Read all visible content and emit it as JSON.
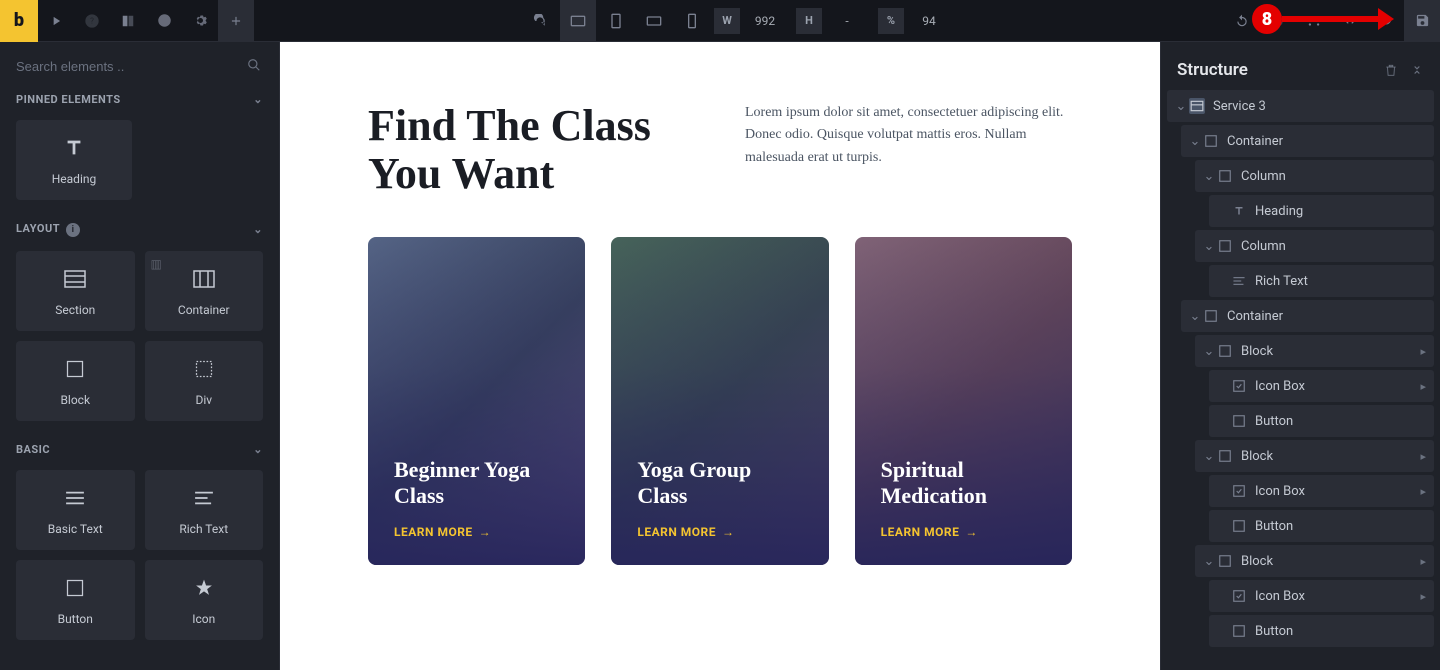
{
  "topbar": {
    "logo": "b",
    "dims": {
      "w_label": "W",
      "w_value": "992",
      "h_label": "H",
      "h_value": "-",
      "pct_label": "%",
      "pct_value": "94"
    }
  },
  "leftPanel": {
    "search_placeholder": "Search elements ..",
    "sections": {
      "pinned": "PINNED ELEMENTS",
      "layout": "LAYOUT",
      "basic": "BASIC"
    },
    "tiles": {
      "heading": "Heading",
      "section": "Section",
      "container": "Container",
      "block": "Block",
      "div": "Div",
      "basicText": "Basic Text",
      "richText": "Rich Text",
      "button": "Button",
      "icon": "Icon"
    }
  },
  "canvas": {
    "hero_title": "Find The Class You Want",
    "hero_text": "Lorem ipsum dolor sit amet, consectetuer adipiscing elit. Donec odio. Quisque volutpat mattis eros. Nullam malesuada erat ut turpis.",
    "cards": [
      {
        "title": "Beginner Yoga Class",
        "cta": "LEARN MORE"
      },
      {
        "title": "Yoga Group Class",
        "cta": "LEARN MORE"
      },
      {
        "title": "Spiritual Medication",
        "cta": "LEARN MORE"
      }
    ]
  },
  "rightPanel": {
    "title": "Structure",
    "tree": [
      {
        "label": "Service 3",
        "indent": 0,
        "icon": "section",
        "toggle": true
      },
      {
        "label": "Container",
        "indent": 1,
        "icon": "container",
        "toggle": true
      },
      {
        "label": "Column",
        "indent": 2,
        "icon": "column",
        "toggle": true
      },
      {
        "label": "Heading",
        "indent": 3,
        "icon": "heading"
      },
      {
        "label": "Column",
        "indent": 2,
        "icon": "column",
        "toggle": true
      },
      {
        "label": "Rich Text",
        "indent": 3,
        "icon": "richtext"
      },
      {
        "label": "Container",
        "indent": 1,
        "icon": "container",
        "toggle": true
      },
      {
        "label": "Block",
        "indent": 2,
        "icon": "block",
        "toggle": true,
        "trailing": true
      },
      {
        "label": "Icon Box",
        "indent": 3,
        "icon": "iconbox",
        "trailing": true
      },
      {
        "label": "Button",
        "indent": 3,
        "icon": "button"
      },
      {
        "label": "Block",
        "indent": 2,
        "icon": "block",
        "toggle": true,
        "trailing": true
      },
      {
        "label": "Icon Box",
        "indent": 3,
        "icon": "iconbox",
        "trailing": true
      },
      {
        "label": "Button",
        "indent": 3,
        "icon": "button"
      },
      {
        "label": "Block",
        "indent": 2,
        "icon": "block",
        "toggle": true,
        "trailing": true
      },
      {
        "label": "Icon Box",
        "indent": 3,
        "icon": "iconbox",
        "trailing": true
      },
      {
        "label": "Button",
        "indent": 3,
        "icon": "button"
      }
    ]
  },
  "annotation": {
    "number": "8"
  },
  "colors": {
    "accent": "#f4c430",
    "cardOverlay": "#25245a"
  }
}
